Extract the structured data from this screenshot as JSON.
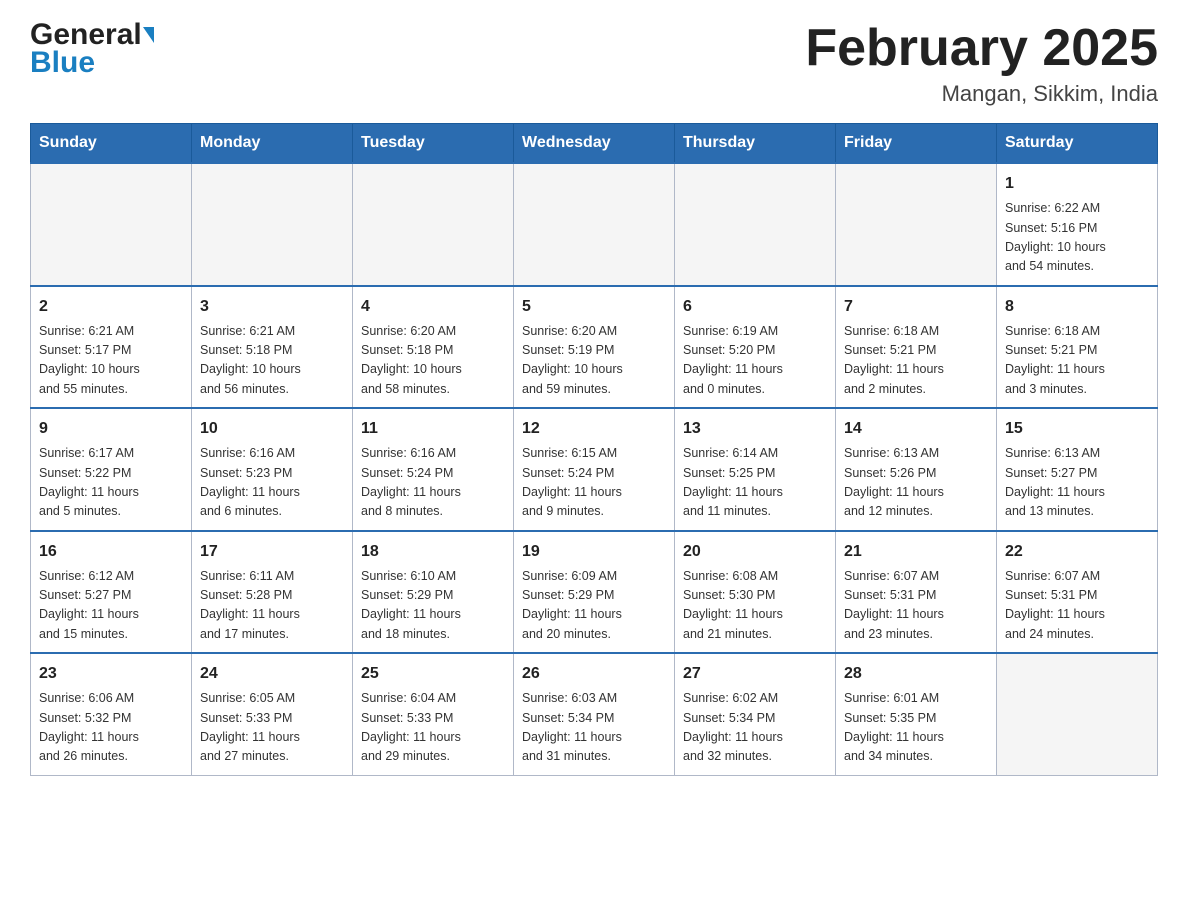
{
  "header": {
    "logo_general": "General",
    "logo_blue": "Blue",
    "month_year": "February 2025",
    "location": "Mangan, Sikkim, India"
  },
  "days_of_week": [
    "Sunday",
    "Monday",
    "Tuesday",
    "Wednesday",
    "Thursday",
    "Friday",
    "Saturday"
  ],
  "weeks": [
    [
      {
        "day": "",
        "info": ""
      },
      {
        "day": "",
        "info": ""
      },
      {
        "day": "",
        "info": ""
      },
      {
        "day": "",
        "info": ""
      },
      {
        "day": "",
        "info": ""
      },
      {
        "day": "",
        "info": ""
      },
      {
        "day": "1",
        "info": "Sunrise: 6:22 AM\nSunset: 5:16 PM\nDaylight: 10 hours\nand 54 minutes."
      }
    ],
    [
      {
        "day": "2",
        "info": "Sunrise: 6:21 AM\nSunset: 5:17 PM\nDaylight: 10 hours\nand 55 minutes."
      },
      {
        "day": "3",
        "info": "Sunrise: 6:21 AM\nSunset: 5:18 PM\nDaylight: 10 hours\nand 56 minutes."
      },
      {
        "day": "4",
        "info": "Sunrise: 6:20 AM\nSunset: 5:18 PM\nDaylight: 10 hours\nand 58 minutes."
      },
      {
        "day": "5",
        "info": "Sunrise: 6:20 AM\nSunset: 5:19 PM\nDaylight: 10 hours\nand 59 minutes."
      },
      {
        "day": "6",
        "info": "Sunrise: 6:19 AM\nSunset: 5:20 PM\nDaylight: 11 hours\nand 0 minutes."
      },
      {
        "day": "7",
        "info": "Sunrise: 6:18 AM\nSunset: 5:21 PM\nDaylight: 11 hours\nand 2 minutes."
      },
      {
        "day": "8",
        "info": "Sunrise: 6:18 AM\nSunset: 5:21 PM\nDaylight: 11 hours\nand 3 minutes."
      }
    ],
    [
      {
        "day": "9",
        "info": "Sunrise: 6:17 AM\nSunset: 5:22 PM\nDaylight: 11 hours\nand 5 minutes."
      },
      {
        "day": "10",
        "info": "Sunrise: 6:16 AM\nSunset: 5:23 PM\nDaylight: 11 hours\nand 6 minutes."
      },
      {
        "day": "11",
        "info": "Sunrise: 6:16 AM\nSunset: 5:24 PM\nDaylight: 11 hours\nand 8 minutes."
      },
      {
        "day": "12",
        "info": "Sunrise: 6:15 AM\nSunset: 5:24 PM\nDaylight: 11 hours\nand 9 minutes."
      },
      {
        "day": "13",
        "info": "Sunrise: 6:14 AM\nSunset: 5:25 PM\nDaylight: 11 hours\nand 11 minutes."
      },
      {
        "day": "14",
        "info": "Sunrise: 6:13 AM\nSunset: 5:26 PM\nDaylight: 11 hours\nand 12 minutes."
      },
      {
        "day": "15",
        "info": "Sunrise: 6:13 AM\nSunset: 5:27 PM\nDaylight: 11 hours\nand 13 minutes."
      }
    ],
    [
      {
        "day": "16",
        "info": "Sunrise: 6:12 AM\nSunset: 5:27 PM\nDaylight: 11 hours\nand 15 minutes."
      },
      {
        "day": "17",
        "info": "Sunrise: 6:11 AM\nSunset: 5:28 PM\nDaylight: 11 hours\nand 17 minutes."
      },
      {
        "day": "18",
        "info": "Sunrise: 6:10 AM\nSunset: 5:29 PM\nDaylight: 11 hours\nand 18 minutes."
      },
      {
        "day": "19",
        "info": "Sunrise: 6:09 AM\nSunset: 5:29 PM\nDaylight: 11 hours\nand 20 minutes."
      },
      {
        "day": "20",
        "info": "Sunrise: 6:08 AM\nSunset: 5:30 PM\nDaylight: 11 hours\nand 21 minutes."
      },
      {
        "day": "21",
        "info": "Sunrise: 6:07 AM\nSunset: 5:31 PM\nDaylight: 11 hours\nand 23 minutes."
      },
      {
        "day": "22",
        "info": "Sunrise: 6:07 AM\nSunset: 5:31 PM\nDaylight: 11 hours\nand 24 minutes."
      }
    ],
    [
      {
        "day": "23",
        "info": "Sunrise: 6:06 AM\nSunset: 5:32 PM\nDaylight: 11 hours\nand 26 minutes."
      },
      {
        "day": "24",
        "info": "Sunrise: 6:05 AM\nSunset: 5:33 PM\nDaylight: 11 hours\nand 27 minutes."
      },
      {
        "day": "25",
        "info": "Sunrise: 6:04 AM\nSunset: 5:33 PM\nDaylight: 11 hours\nand 29 minutes."
      },
      {
        "day": "26",
        "info": "Sunrise: 6:03 AM\nSunset: 5:34 PM\nDaylight: 11 hours\nand 31 minutes."
      },
      {
        "day": "27",
        "info": "Sunrise: 6:02 AM\nSunset: 5:34 PM\nDaylight: 11 hours\nand 32 minutes."
      },
      {
        "day": "28",
        "info": "Sunrise: 6:01 AM\nSunset: 5:35 PM\nDaylight: 11 hours\nand 34 minutes."
      },
      {
        "day": "",
        "info": ""
      }
    ]
  ]
}
